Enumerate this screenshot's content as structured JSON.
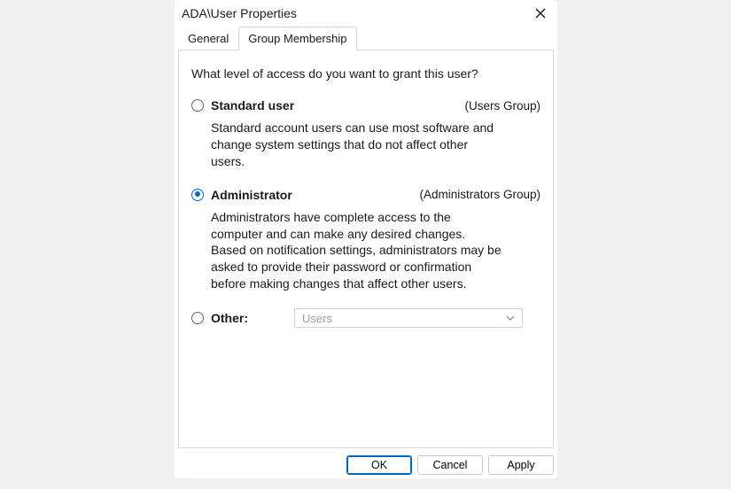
{
  "window": {
    "title": "ADA\\User Properties"
  },
  "tabs": {
    "general": "General",
    "group_membership": "Group Membership",
    "active": "group_membership"
  },
  "panel": {
    "prompt": "What level of access do you want to grant this user?",
    "options": {
      "standard": {
        "label": "Standard user",
        "group": "(Users Group)",
        "desc": "Standard account users can use most software and change system settings that do not affect other users.",
        "selected": false
      },
      "administrator": {
        "label": "Administrator",
        "group": "(Administrators Group)",
        "desc": "Administrators have complete access to the computer and can make any desired changes. Based on notification settings, administrators may be asked to provide their password or confirmation before making changes that affect other users.",
        "selected": true
      },
      "other": {
        "label": "Other:",
        "dropdown_value": "Users",
        "selected": false
      }
    }
  },
  "buttons": {
    "ok": "OK",
    "cancel": "Cancel",
    "apply": "Apply"
  }
}
